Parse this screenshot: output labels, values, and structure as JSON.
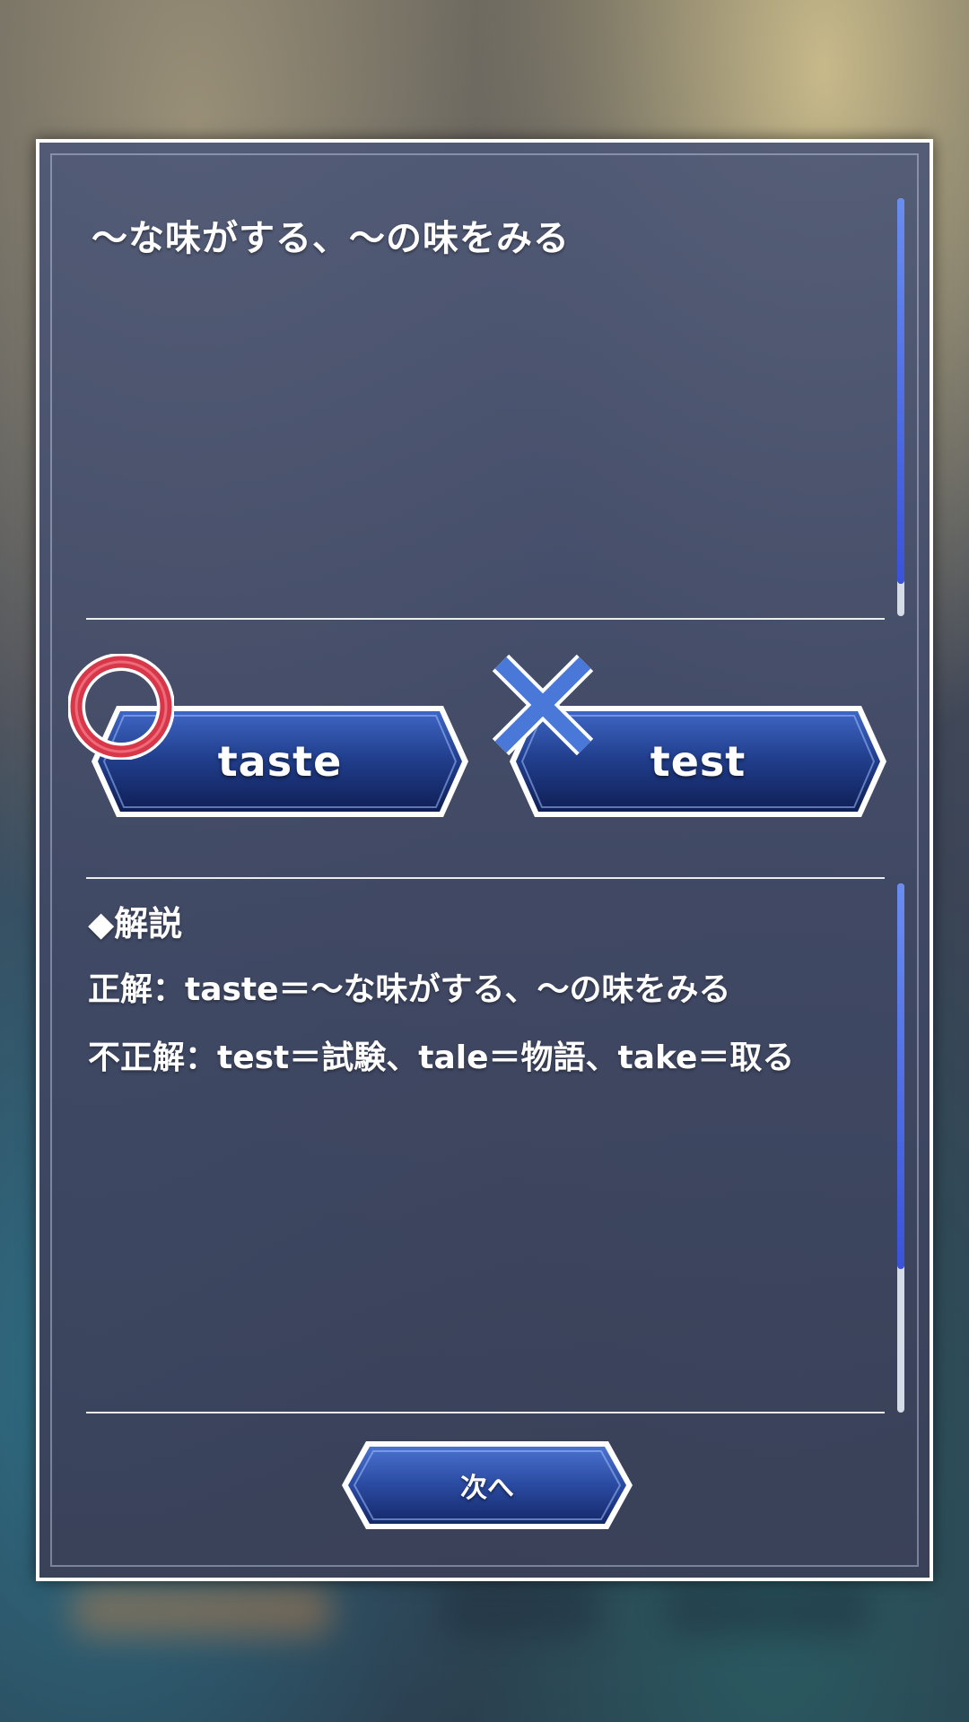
{
  "question": {
    "text": "～な味がする、～の味をみる"
  },
  "answers": [
    {
      "label": "taste",
      "result": "correct",
      "result_icon": "circle-correct-icon",
      "result_color": "#d8374a"
    },
    {
      "label": "test",
      "result": "wrong",
      "result_icon": "cross-wrong-icon",
      "result_color": "#4a78d8"
    }
  ],
  "explanation": {
    "heading": "◆解説",
    "correct_line": "正解：taste＝～な味がする、～の味をみる",
    "incorrect_line": "不正解：test＝試験、tale＝物語、take＝取る"
  },
  "footer": {
    "next_label": "次へ"
  },
  "colors": {
    "button_fill": "#1c3580",
    "button_border": "#ffffff",
    "scroll_thumb": "#3b52d9",
    "panel_bg": "#4e5876"
  }
}
